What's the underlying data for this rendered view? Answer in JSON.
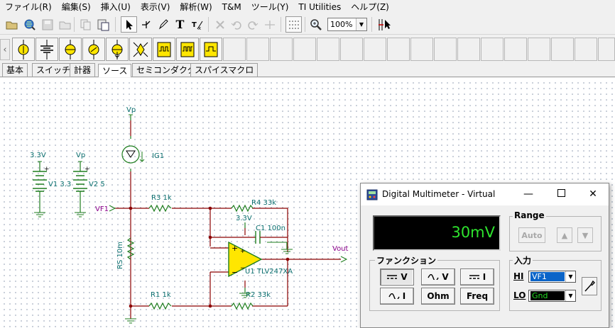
{
  "menu": [
    "ファイル(R)",
    "編集(S)",
    "挿入(U)",
    "表示(V)",
    "解析(W)",
    "T&M",
    "ツール(Y)",
    "TI Utilities",
    "ヘルプ(Z)"
  ],
  "toolbar": {
    "zoom": "100%"
  },
  "palette_tabs": [
    "基本",
    "スイッチ",
    "計器",
    "ソース",
    "セミコンダクタ",
    "スパイスマクロ"
  ],
  "active_tab": "ソース",
  "schematic": {
    "vp_top": "Vp",
    "ig1": "IG1",
    "v1_node": "3.3V",
    "v1_label": "V1 3.3",
    "v2_node": "Vp",
    "v2_label": "V2 5",
    "vf1": "VF1",
    "r3": "R3 1k",
    "r4": "R4 33k",
    "node_33v": "3.3V",
    "c1": "C1 100n",
    "rs": "RS 10m",
    "u1": "U1 TLV247XA",
    "vout": "Vout",
    "r1": "R1 1k",
    "r2": "R2 33k"
  },
  "dmm": {
    "title": "Digital Multimeter - Virtual",
    "display": "30mV",
    "range_label": "Range",
    "auto": "Auto",
    "up": "▲",
    "down": "▼",
    "function_label": "ファンクション",
    "functions": [
      "V",
      "V",
      "I",
      "I",
      "Ohm",
      "Freq"
    ],
    "input_label": "入力",
    "hi_label": "HI",
    "hi_value": "VF1",
    "lo_label": "LO",
    "lo_value": "Gnd",
    "colors": {
      "display_text": "#2ee22e",
      "hi_bg": "#0a64c8",
      "lo_bg": "#000000",
      "lo_text": "#22dd22"
    }
  }
}
